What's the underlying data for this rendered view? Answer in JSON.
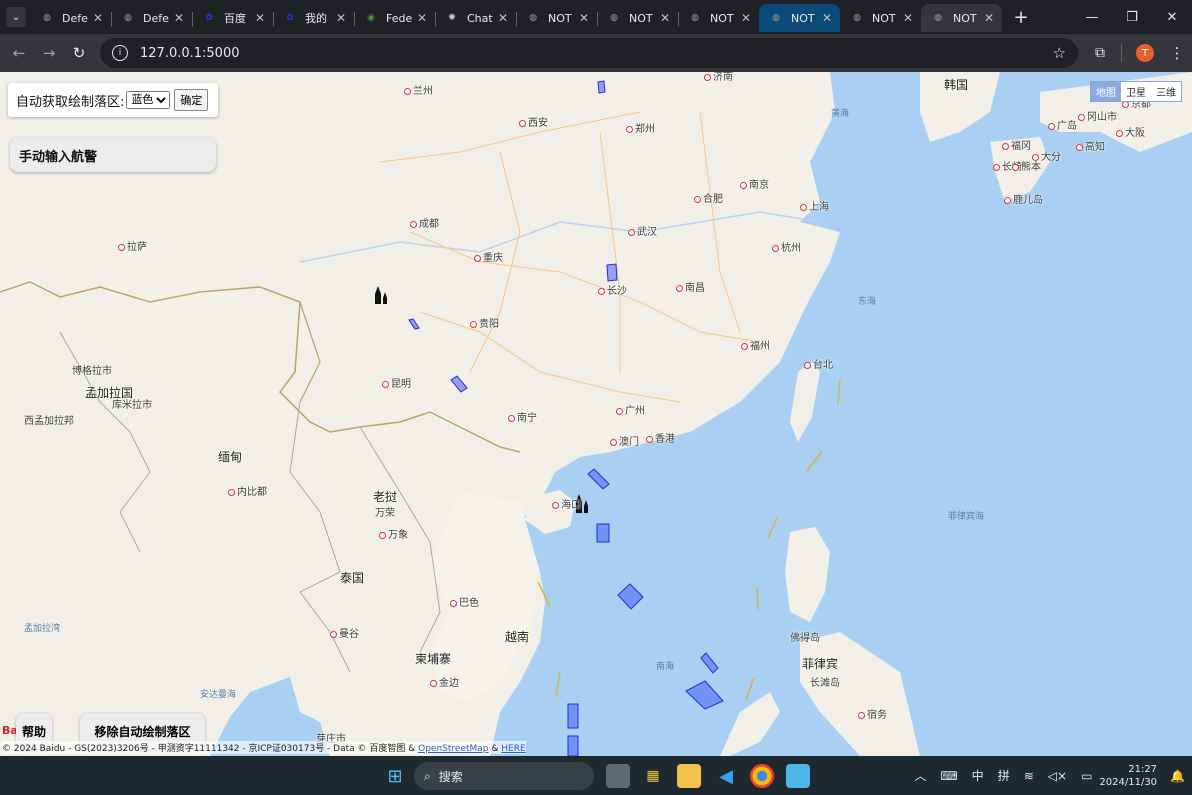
{
  "browser": {
    "tabs": [
      {
        "title": "Defe",
        "icon": "globe-icon"
      },
      {
        "title": "Defe",
        "icon": "globe-icon"
      },
      {
        "title": "百度",
        "icon": "baidu-icon"
      },
      {
        "title": "我的",
        "icon": "baidu-icon"
      },
      {
        "title": "Fede",
        "icon": "seal-icon"
      },
      {
        "title": "Chat",
        "icon": "openai-icon"
      },
      {
        "title": "NOT",
        "icon": "globe-icon"
      },
      {
        "title": "NOT",
        "icon": "globe-icon"
      },
      {
        "title": "NOT",
        "icon": "globe-icon"
      },
      {
        "title": "NOT",
        "icon": "globe-icon"
      },
      {
        "title": "NOT",
        "icon": "globe-icon"
      },
      {
        "title": "NOT",
        "icon": "globe-icon"
      }
    ],
    "url": "127.0.0.1:5000",
    "profile_initial": "T"
  },
  "controls": {
    "auto_label": "自动获取绘制落区:",
    "color_selected": "蓝色",
    "confirm": "确定",
    "manual": "手动输入航警",
    "help": "帮助",
    "remove": "移除自动绘制落区",
    "maptypes": [
      "地图",
      "卫星",
      "三维"
    ]
  },
  "map": {
    "labels": [
      {
        "text": "兰州",
        "type": "city"
      },
      {
        "text": "西安",
        "type": "city"
      },
      {
        "text": "郑州",
        "type": "city"
      },
      {
        "text": "济南",
        "type": "city"
      },
      {
        "text": "韩国",
        "type": "country"
      },
      {
        "text": "黄海",
        "type": "sea"
      },
      {
        "text": "南京",
        "type": "city"
      },
      {
        "text": "合肥",
        "type": "city"
      },
      {
        "text": "上海",
        "type": "city"
      },
      {
        "text": "成都",
        "type": "city"
      },
      {
        "text": "武汉",
        "type": "city"
      },
      {
        "text": "杭州",
        "type": "city"
      },
      {
        "text": "拉萨",
        "type": "city"
      },
      {
        "text": "重庆",
        "type": "city"
      },
      {
        "text": "长沙",
        "type": "city"
      },
      {
        "text": "南昌",
        "type": "city"
      },
      {
        "text": "东海",
        "type": "sea"
      },
      {
        "text": "贵阳",
        "type": "city"
      },
      {
        "text": "福州",
        "type": "city"
      },
      {
        "text": "台北",
        "type": "city"
      },
      {
        "text": "昆明",
        "type": "city"
      },
      {
        "text": "南宁",
        "type": "city"
      },
      {
        "text": "广州",
        "type": "city"
      },
      {
        "text": "澳门",
        "type": "city"
      },
      {
        "text": "香港",
        "type": "city"
      },
      {
        "text": "海口",
        "type": "city"
      },
      {
        "text": "缅甸",
        "type": "country"
      },
      {
        "text": "老挝",
        "type": "country"
      },
      {
        "text": "泰国",
        "type": "country"
      },
      {
        "text": "越南",
        "type": "country"
      },
      {
        "text": "柬埔寨",
        "type": "country"
      },
      {
        "text": "菲律宾",
        "type": "country"
      },
      {
        "text": "南海",
        "type": "sea"
      },
      {
        "text": "菲律宾海",
        "type": "sea"
      },
      {
        "text": "孟加拉国",
        "type": "country"
      },
      {
        "text": "西孟加拉邦",
        "type": "region"
      },
      {
        "text": "孟加拉湾",
        "type": "sea"
      },
      {
        "text": "安达曼海",
        "type": "sea"
      },
      {
        "text": "内比都",
        "type": "city"
      },
      {
        "text": "万荣",
        "type": "region"
      },
      {
        "text": "万象",
        "type": "city"
      },
      {
        "text": "曼谷",
        "type": "city"
      },
      {
        "text": "巴色",
        "type": "city"
      },
      {
        "text": "金边",
        "type": "city"
      },
      {
        "text": "佛得岛",
        "type": "region"
      },
      {
        "text": "博格拉市",
        "type": "region"
      },
      {
        "text": "库米拉市",
        "type": "region"
      },
      {
        "text": "广岛",
        "type": "city"
      },
      {
        "text": "冈山市",
        "type": "city"
      },
      {
        "text": "京都",
        "type": "city"
      },
      {
        "text": "大阪",
        "type": "city"
      },
      {
        "text": "福冈",
        "type": "city"
      },
      {
        "text": "大分",
        "type": "city"
      },
      {
        "text": "长崎",
        "type": "city"
      },
      {
        "text": "熊本",
        "type": "city"
      },
      {
        "text": "高知",
        "type": "city"
      },
      {
        "text": "鹿儿岛",
        "type": "city"
      },
      {
        "text": "长滩岛",
        "type": "region"
      },
      {
        "text": "宿务",
        "type": "city"
      },
      {
        "text": "芽庄市",
        "type": "region"
      }
    ],
    "baidu_logo": "Bai",
    "copyright_text": "© 2024 Baidu - GS(2023)3206号 - 甲测资字11111342 - 京ICP证030173号 - Data © 百度智图 & ",
    "copyright_osm": "OpenStreetMap",
    "copyright_amp": " & ",
    "copyright_here": "HERE"
  },
  "taskbar": {
    "search_placeholder": "搜索",
    "ime_1": "中",
    "ime_2": "拼",
    "time": "21:27",
    "date": "2024/11/30"
  }
}
